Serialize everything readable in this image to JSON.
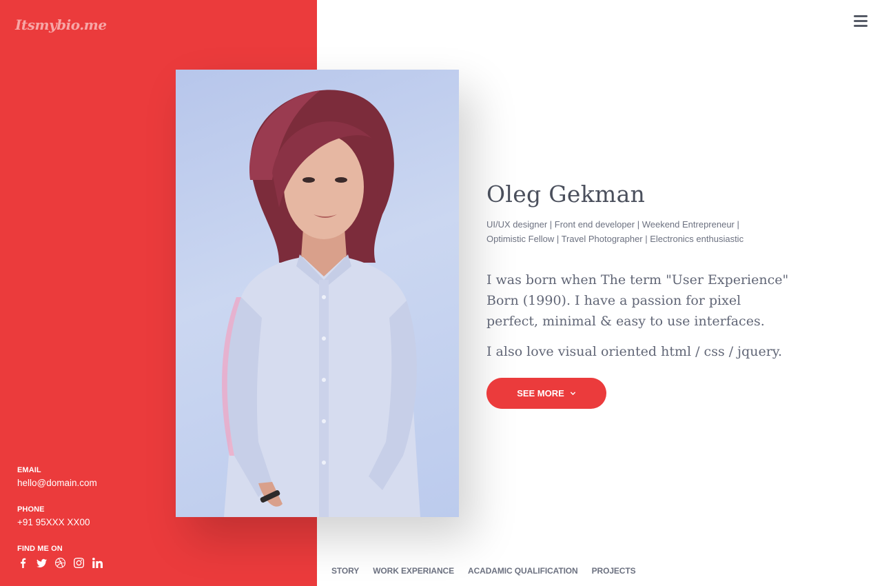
{
  "brand": {
    "logo_text": "Itsmybio.me"
  },
  "menu": {
    "icon": "hamburger-menu-icon"
  },
  "contact": {
    "email_label": "EMAIL",
    "email_value": "hello@domain.com",
    "phone_label": "PHONE",
    "phone_value": "+91 95XXX XX00",
    "find_label": "FIND ME ON",
    "social": [
      "facebook-icon",
      "twitter-icon",
      "dribbble-icon",
      "instagram-icon",
      "linkedin-icon"
    ]
  },
  "profile": {
    "name": "Oleg Gekman",
    "tagline": "UI/UX designer | Front end developer | Weekend Entrepreneur | Optimistic Fellow | Travel Photographer | Electronics enthusiastic",
    "intro": "I was born when The term \"User Experience\" Born (1990). I have a passion for pixel perfect, minimal & easy to use interfaces.",
    "intro2": "I also love visual oriented html / css / jquery.",
    "see_more_label": "SEE MORE"
  },
  "nav": {
    "items": [
      "STORY",
      "WORK EXPERIANCE",
      "ACADAMIC QUALIFICATION",
      "PROJECTS"
    ]
  },
  "colors": {
    "accent": "#eb3b3c",
    "text": "#555a66",
    "background": "#ffffff"
  }
}
